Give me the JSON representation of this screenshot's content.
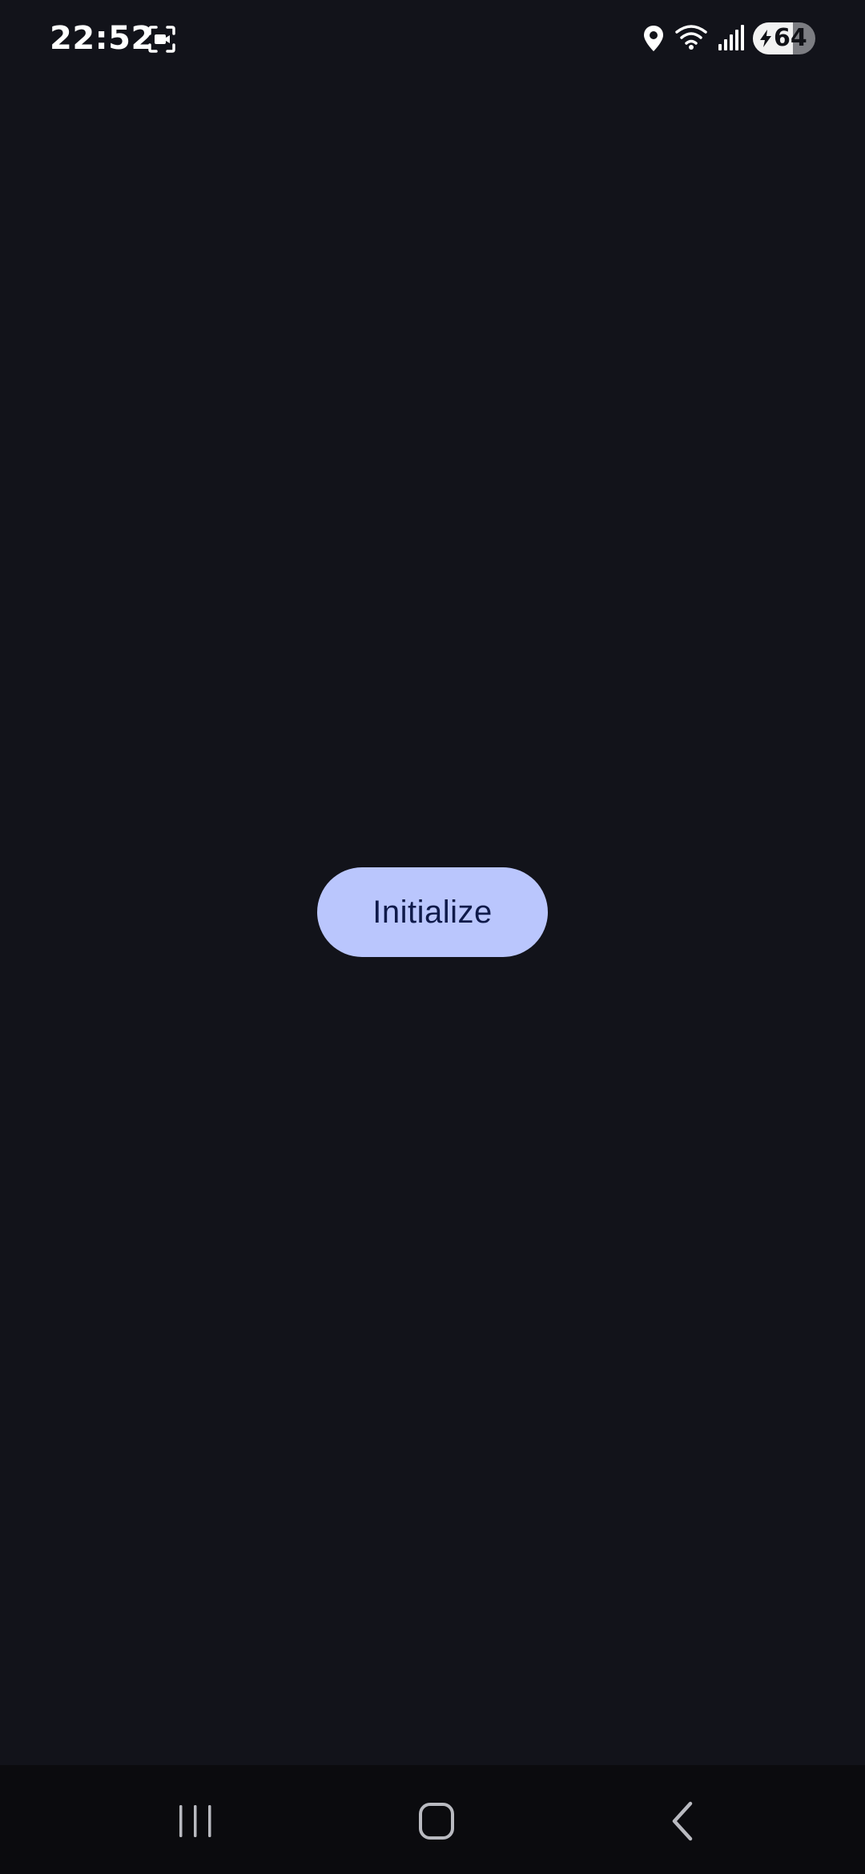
{
  "status_bar": {
    "time": "22:52",
    "battery_level": "64",
    "battery_fraction": 0.64,
    "charging": true,
    "icons": [
      "screen-record-icon",
      "location-icon",
      "wifi-icon",
      "signal-icon",
      "battery-icon",
      "charging-bolt-icon"
    ]
  },
  "main": {
    "initialize_label": "Initialize"
  },
  "nav_bar": {
    "buttons": [
      "recents",
      "home",
      "back"
    ]
  },
  "colors": {
    "background": "#12131a",
    "button_bg": "#bac6fd",
    "button_text": "#0f1a4a",
    "nav_bg": "#0b0b0e"
  }
}
